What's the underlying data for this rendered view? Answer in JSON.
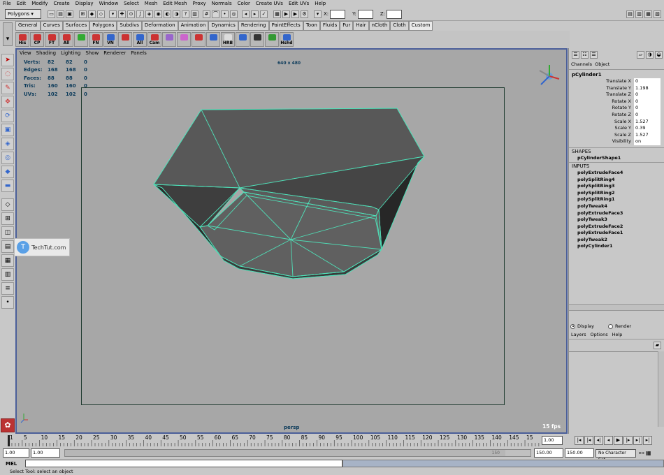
{
  "menubar": [
    "File",
    "Edit",
    "Modify",
    "Create",
    "Display",
    "Window",
    "Select",
    "Mesh",
    "Edit Mesh",
    "Proxy",
    "Normals",
    "Color",
    "Create UVs",
    "Edit UVs",
    "Help"
  ],
  "status_line": {
    "menu_set": "Polygons",
    "x_label": "X:",
    "y_label": "Y:",
    "z_label": "Z:"
  },
  "shelf_tabs": [
    "General",
    "Curves",
    "Surfaces",
    "Polygons",
    "Subdivs",
    "Deformation",
    "Animation",
    "Dynamics",
    "Rendering",
    "PaintEffects",
    "Toon",
    "Fluids",
    "Fur",
    "Hair",
    "nCloth",
    "Cloth",
    "Custom"
  ],
  "shelf_active_tab": "Custom",
  "shelf_buttons": [
    "His",
    "CP",
    "FT",
    "All",
    "",
    "FN",
    "VN",
    "",
    "All",
    "Cam",
    "",
    "",
    "",
    "",
    "HRB",
    "",
    "",
    "",
    "Hshd"
  ],
  "viewport": {
    "menu": [
      "View",
      "Shading",
      "Lighting",
      "Show",
      "Renderer",
      "Panels"
    ],
    "resolution": "640 x 480",
    "camera": "persp",
    "fps": "15 fps",
    "hud": [
      {
        "label": "Verts:",
        "a": "82",
        "b": "82",
        "c": "0"
      },
      {
        "label": "Edges:",
        "a": "168",
        "b": "168",
        "c": "0"
      },
      {
        "label": "Faces:",
        "a": "88",
        "b": "88",
        "c": "0"
      },
      {
        "label": "Tris:",
        "a": "160",
        "b": "160",
        "c": "0"
      },
      {
        "label": "UVs:",
        "a": "102",
        "b": "102",
        "c": "0"
      }
    ],
    "watermark": "TechTut.com"
  },
  "channel_box": {
    "tabs": [
      "Channels",
      "Object"
    ],
    "object_name": "pCylinder1",
    "attributes": [
      {
        "name": "Translate X",
        "value": "0"
      },
      {
        "name": "Translate Y",
        "value": "1.198"
      },
      {
        "name": "Translate Z",
        "value": "0"
      },
      {
        "name": "Rotate X",
        "value": "0"
      },
      {
        "name": "Rotate Y",
        "value": "0"
      },
      {
        "name": "Rotate Z",
        "value": "0"
      },
      {
        "name": "Scale X",
        "value": "1.527"
      },
      {
        "name": "Scale Y",
        "value": "0.39"
      },
      {
        "name": "Scale Z",
        "value": "1.527"
      },
      {
        "name": "Visibility",
        "value": "on"
      }
    ],
    "shapes_header": "SHAPES",
    "shape_name": "pCylinderShape1",
    "inputs_header": "INPUTS",
    "inputs": [
      "polyExtrudeFace4",
      "polySplitRing4",
      "polySplitRing3",
      "polySplitRing2",
      "polySplitRing1",
      "polyTweak4",
      "polyExtrudeFace3",
      "polyTweak3",
      "polyExtrudeFace2",
      "polyExtrudeFace1",
      "polyTweak2",
      "polyCylinder1"
    ]
  },
  "layer_editor": {
    "display_label": "Display",
    "render_label": "Render",
    "menu": [
      "Layers",
      "Options",
      "Help"
    ]
  },
  "timeline": {
    "ticks": [
      "1",
      "5",
      "10",
      "15",
      "20",
      "25",
      "30",
      "35",
      "40",
      "45",
      "50",
      "55",
      "60",
      "65",
      "70",
      "75",
      "80",
      "85",
      "90",
      "95",
      "100",
      "105",
      "110",
      "115",
      "120",
      "125",
      "130",
      "135",
      "140",
      "145",
      "15"
    ],
    "current_frame": "1.00"
  },
  "range": {
    "start": "1.00",
    "playback_start": "1.00",
    "range_end_label": "150",
    "playback_end": "150.00",
    "end": "150.00",
    "character_set": "No Character Set"
  },
  "command_line": {
    "label": "MEL"
  },
  "help_line": "Select Tool: select an object"
}
